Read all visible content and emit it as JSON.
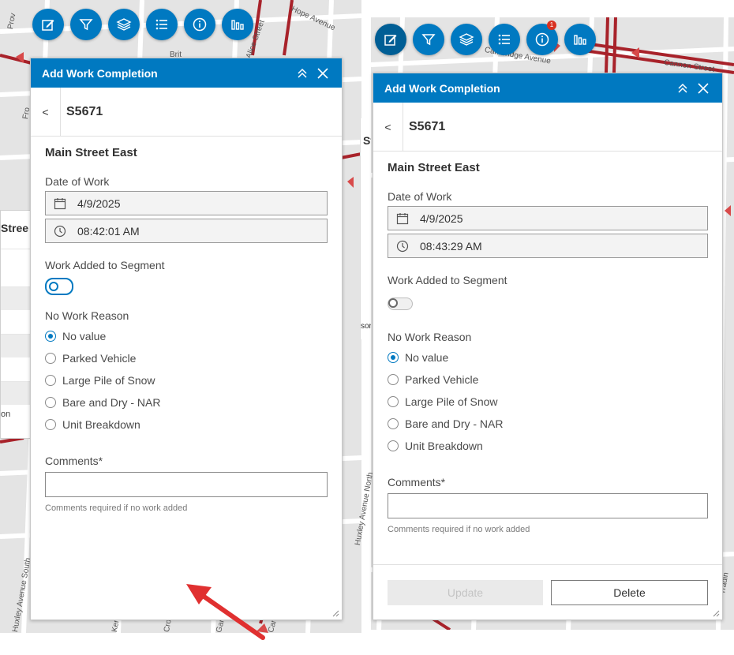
{
  "toolbar": {
    "buttons": [
      {
        "name": "edit",
        "icon": "edit-icon"
      },
      {
        "name": "filter",
        "icon": "filter-icon"
      },
      {
        "name": "layers",
        "icon": "layers-icon"
      },
      {
        "name": "legend",
        "icon": "list-icon"
      },
      {
        "name": "info",
        "icon": "info-icon"
      },
      {
        "name": "chart",
        "icon": "chart-icon"
      }
    ],
    "info_badge": "1",
    "accent_color": "#0079c1",
    "active_color": "#005e95"
  },
  "map_labels": {
    "hope_avenue": "Hope Avenue",
    "alice_street": "Alice Street",
    "cambridge_avenue": "Cambridge Avenue",
    "cannon_street": "Cannon Street",
    "huxley_avenue_south": "Huxley Avenue South",
    "huxley_avenue_north": "Huxley Avenue North",
    "kenilworth": "Kenilw",
    "crosthwaite": "Crosthwai",
    "garside": "Garside Ave",
    "cameron": "Cameron Av",
    "fro": "Fro",
    "prov": "Prov",
    "brit": "Brit",
    "tradin": "Tradin"
  },
  "underlying": {
    "left_title": "Stree",
    "left_footer": "on",
    "right_title": "St",
    "right_footer": "sor"
  },
  "panel_left": {
    "title": "Add Work Completion",
    "back_label": "<",
    "feature_id": "S5671",
    "section_title": "Main Street East",
    "date_label": "Date of Work",
    "date_value": "4/9/2025",
    "time_value": "08:42:01 AM",
    "work_added_label": "Work Added to Segment",
    "no_work_reason_label": "No Work Reason",
    "reasons": [
      "No value",
      "Parked Vehicle",
      "Large Pile of Snow",
      "Bare and Dry - NAR",
      "Unit Breakdown"
    ],
    "selected_reason": "No value",
    "comments_label": "Comments*",
    "comments_value": "",
    "comments_hint": "Comments required if no work added"
  },
  "panel_right": {
    "title": "Add Work Completion",
    "back_label": "<",
    "feature_id": "S5671",
    "section_title": "Main Street East",
    "date_label": "Date of Work",
    "date_value": "4/9/2025",
    "time_value": "08:43:29 AM",
    "work_added_label": "Work Added to Segment",
    "no_work_reason_label": "No Work Reason",
    "reasons": [
      "No value",
      "Parked Vehicle",
      "Large Pile of Snow",
      "Bare and Dry - NAR",
      "Unit Breakdown"
    ],
    "selected_reason": "No value",
    "comments_label": "Comments*",
    "comments_value": "",
    "comments_hint": "Comments required if no work added",
    "update_label": "Update",
    "delete_label": "Delete"
  },
  "annotation": {
    "arrow_color": "#e03030"
  }
}
